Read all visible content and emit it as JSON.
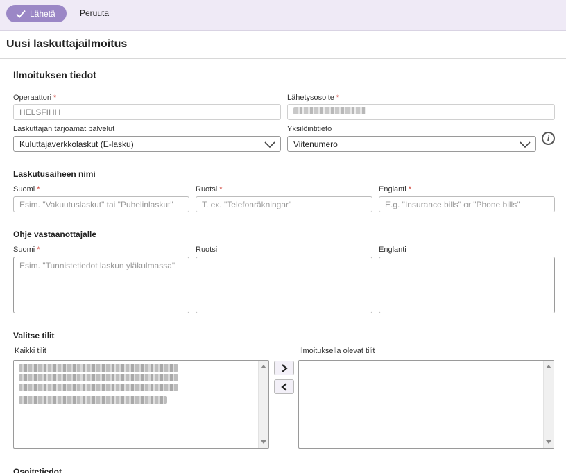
{
  "toolbar": {
    "send_label": "Lähetä",
    "cancel_label": "Peruuta"
  },
  "page": {
    "title": "Uusi laskuttajailmoitus"
  },
  "notice_info": {
    "heading": "Ilmoituksen tiedot",
    "operator": {
      "label": "Operaattori",
      "value": "HELSFIHH"
    },
    "send_address": {
      "label": "Lähetysosoite",
      "value": ""
    },
    "services": {
      "label": "Laskuttajan tarjoamat palvelut",
      "value": "Kuluttajaverkkolaskut (E-lasku)"
    },
    "identifier": {
      "label": "Yksilöintitieto",
      "value": "Viitenumero"
    },
    "required_mark": "*"
  },
  "billing_subject": {
    "heading": "Laskutusaiheen nimi",
    "fi": {
      "label": "Suomi",
      "placeholder": "Esim. \"Vakuutuslaskut\" tai \"Puhelinlaskut\""
    },
    "sv": {
      "label": "Ruotsi",
      "placeholder": "T. ex. \"Telefonräkningar\""
    },
    "en": {
      "label": "Englanti",
      "placeholder": "E.g. \"Insurance bills\" or \"Phone bills\""
    }
  },
  "recipient_guide": {
    "heading": "Ohje vastaanottajalle",
    "fi": {
      "label": "Suomi",
      "placeholder": "Esim. \"Tunnistetiedot laskun yläkulmassa\""
    },
    "sv": {
      "label": "Ruotsi",
      "placeholder": ""
    },
    "en": {
      "label": "Englanti",
      "placeholder": ""
    }
  },
  "accounts": {
    "heading": "Valitse tilit",
    "all_label": "Kaikki tilit",
    "selected_label": "Ilmoituksella olevat tilit",
    "move_right": "›",
    "move_left": "‹"
  },
  "address": {
    "heading": "Osoitetiedot"
  },
  "colors": {
    "accent": "#9b87c6",
    "toolbar_bg": "#efeaf6",
    "required": "#d0463c"
  }
}
